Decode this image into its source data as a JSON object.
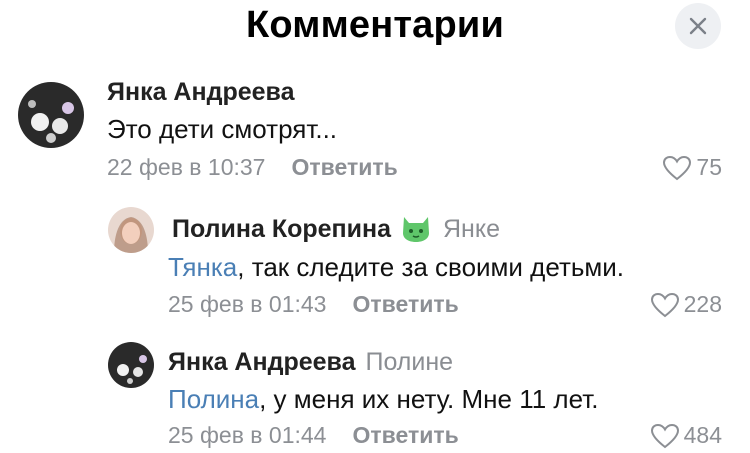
{
  "header": {
    "title": "Комментарии"
  },
  "comments": [
    {
      "author": "Янка Андреева",
      "reply_to": "",
      "mention": "",
      "text": "Это дети смотрят...",
      "date": "22 фев в 10:37",
      "reply_label": "Ответить",
      "likes": "75"
    },
    {
      "author": "Полина Корепина",
      "reply_to": "Янке",
      "mention": "Тянка",
      "text": ", так следите за своими детьми.",
      "date": "25 фев в 01:43",
      "reply_label": "Ответить",
      "likes": "228"
    },
    {
      "author": "Янка Андреева",
      "reply_to": "Полине",
      "mention": "Полина",
      "text": ", у меня их нету. Мне 11 лет.",
      "date": "25 фев в 01:44",
      "reply_label": "Ответить",
      "likes": "484"
    }
  ],
  "colors": {
    "mention": "#4a7fb5",
    "meta": "#8c8f94",
    "close_bg": "#eef0f3"
  },
  "icons": [
    "close-icon",
    "heart-icon",
    "cat-sticker-icon"
  ]
}
